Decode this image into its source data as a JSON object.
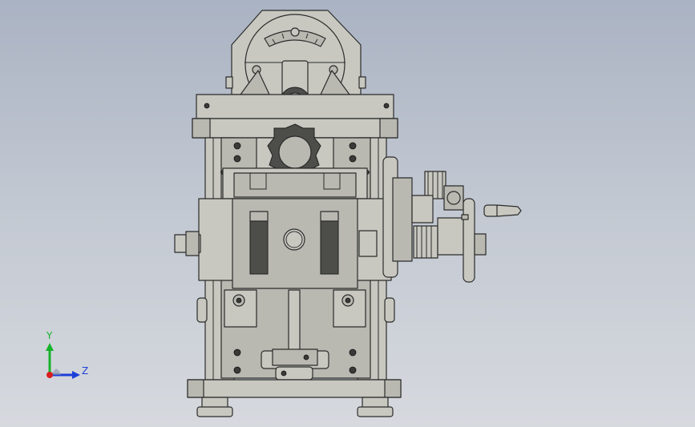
{
  "triad": {
    "y_label": "Y",
    "z_label": "Z",
    "x_color": "#d81e1e",
    "y_color": "#15b22a",
    "z_color": "#1c3fd8"
  },
  "model": {
    "view": "front",
    "material_color": "#c8c8c1"
  }
}
